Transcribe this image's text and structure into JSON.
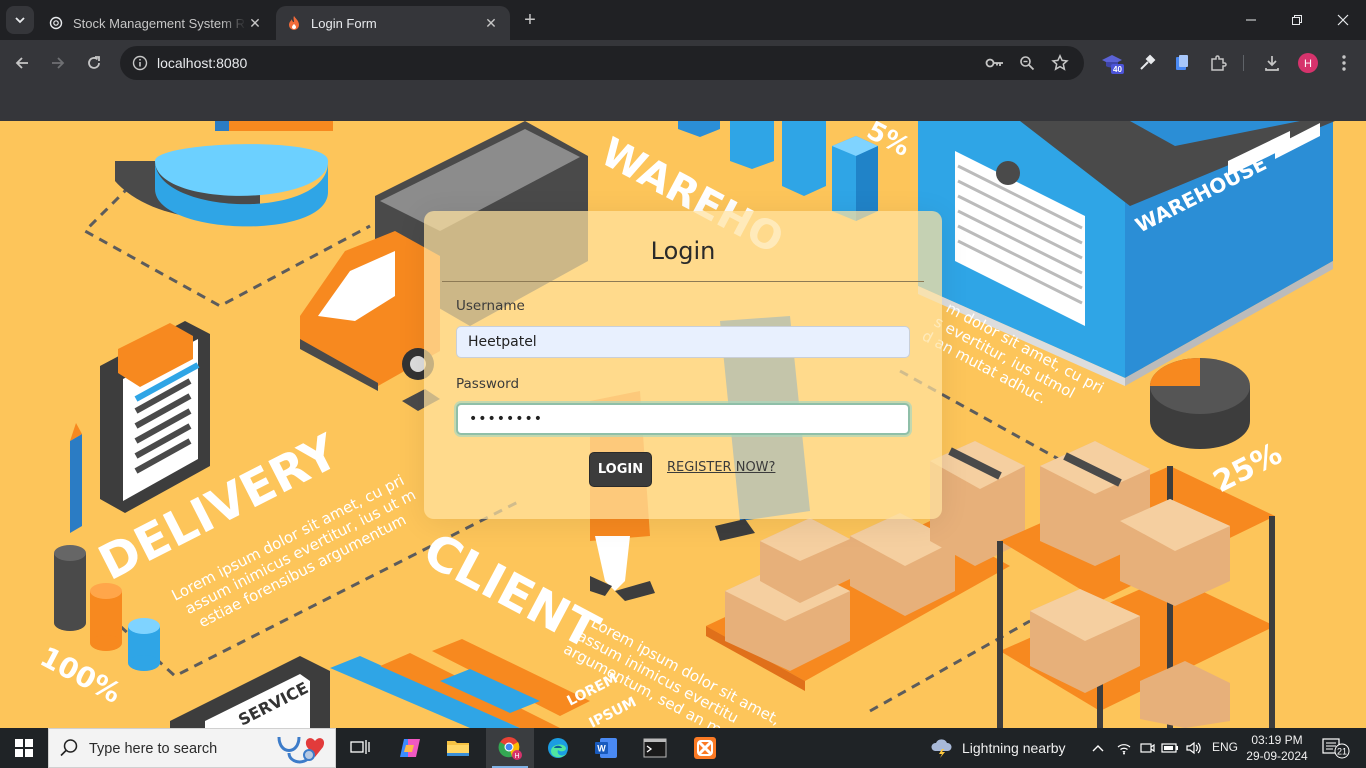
{
  "browser": {
    "tabs": [
      {
        "title": "Stock Management System Rep",
        "favicon": "openai-icon",
        "active": false
      },
      {
        "title": "Login Form",
        "favicon": "fire-icon",
        "active": true
      }
    ],
    "url": "localhost:8080",
    "extension_badge": "40",
    "profile_initial": "H"
  },
  "background": {
    "labels": {
      "warehouse_building": "WAREHOUSE",
      "warehouse_road": "WAREHO",
      "delivery": "DELIVERY",
      "client": "CLIENT",
      "percent_25": "25%",
      "percent_100": "100%",
      "percent_top": "5%",
      "service": "SERVICE",
      "lorem_a": "LOREM",
      "lorem_b": "IPSUM"
    },
    "lorem_delivery": [
      "Lorem ipsum dolor sit amet, cu pri",
      "assum inimicus evertitur, ius ut m",
      "estiae forensibus argumentum"
    ],
    "lorem_client": [
      "Lorem ipsum dolor sit amet,",
      "assum inimicus evertitu",
      "argumentum, sed an m"
    ],
    "lorem_warehouse": [
      "m dolor sit amet, cu pri",
      "s evertitur, ius utmol",
      "d an mutat adhuc."
    ]
  },
  "login": {
    "title": "Login",
    "username_label": "Username",
    "username_value": "Heetpatel",
    "password_label": "Password",
    "password_value": "••••••••",
    "login_button": "LOGIN",
    "register_link": "REGISTER NOW?"
  },
  "taskbar": {
    "search_placeholder": "Type here to search",
    "weather": "Lightning nearby",
    "language": "ENG",
    "time": "03:19 PM",
    "date": "29-09-2024",
    "notifications": "21"
  },
  "colors": {
    "page_bg": "#fdc55a",
    "accent_blue": "#2fa5e6",
    "accent_orange": "#f7891f",
    "dark_grey": "#4a4a4a"
  }
}
